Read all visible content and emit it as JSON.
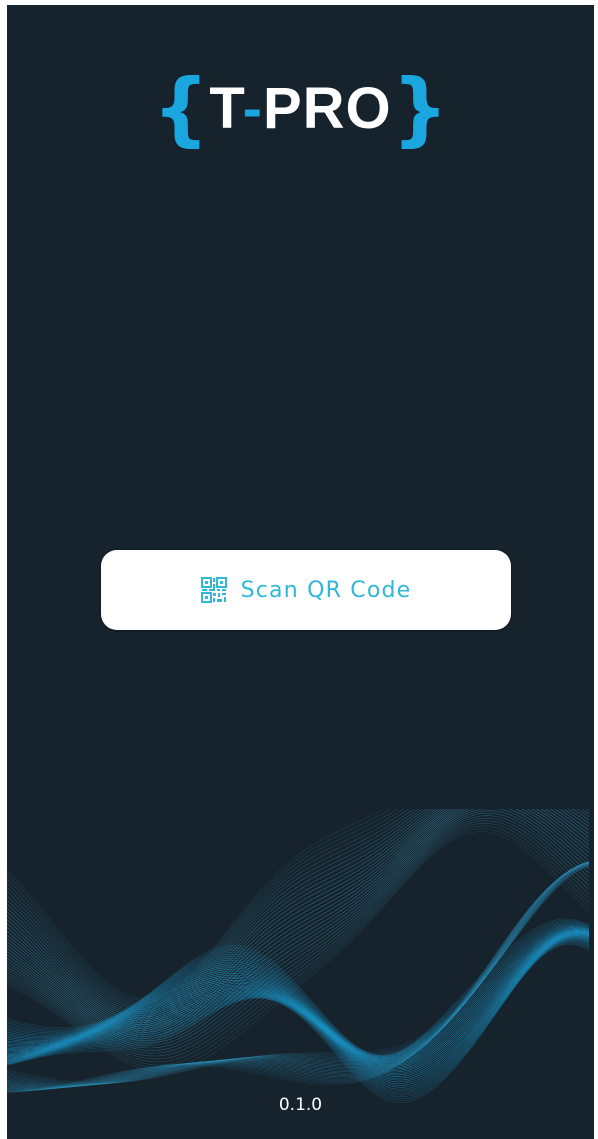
{
  "app": {
    "logo_open_brace": "{",
    "logo_t": "T",
    "logo_hyphen": "-",
    "logo_rest": "PRO",
    "logo_close_brace": "}",
    "version": "0.1.0"
  },
  "scan_button": {
    "label": "Scan QR Code",
    "icon": "qr-code-icon"
  },
  "colors": {
    "background": "#17232c",
    "accent": "#1aa6df",
    "button_text": "#2fb8d8",
    "button_bg": "#ffffff"
  }
}
